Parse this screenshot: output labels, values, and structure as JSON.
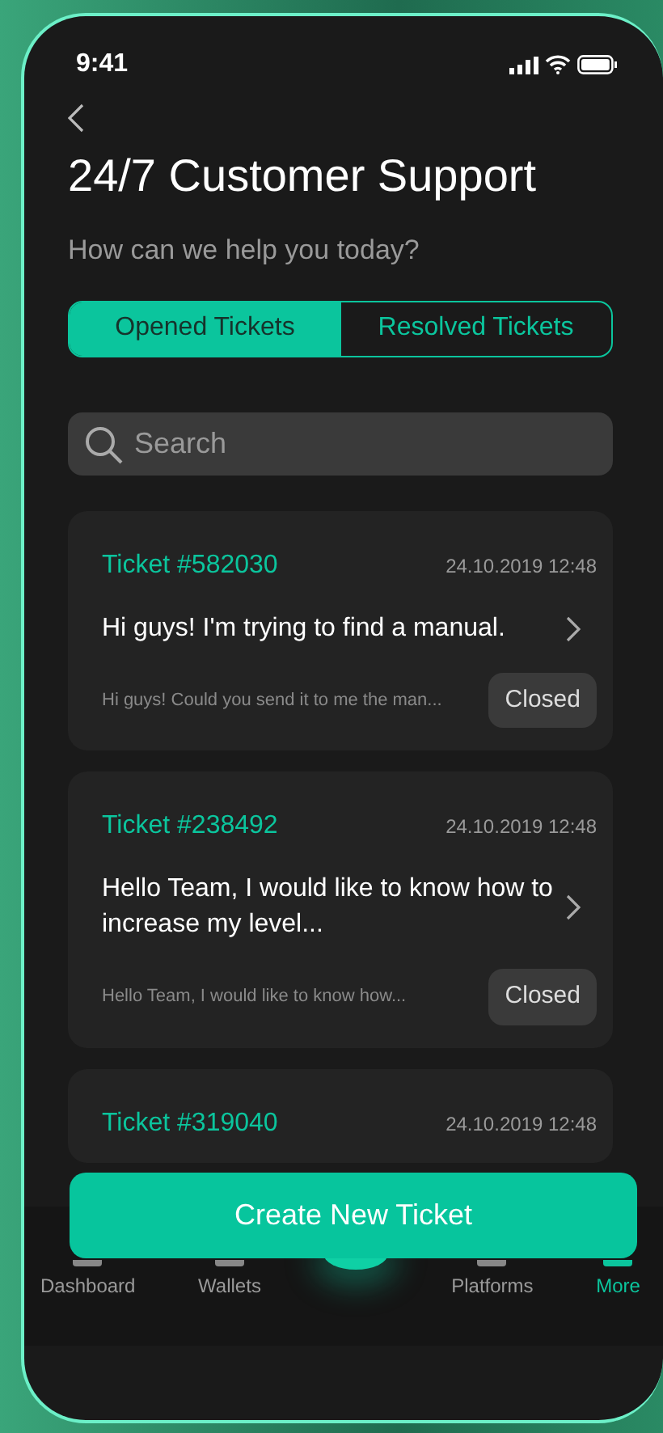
{
  "status_bar": {
    "time": "9:41"
  },
  "header": {
    "title": "24/7 Customer Support",
    "subtitle": "How can we help you today?"
  },
  "tabs": [
    {
      "label": "Opened Tickets",
      "selected": true
    },
    {
      "label": "Resolved Tickets",
      "selected": false
    }
  ],
  "search": {
    "placeholder": "Search"
  },
  "tickets": [
    {
      "number": "Ticket #582030",
      "date": "24.10.2019 12:48",
      "subject": "Hi guys! I'm trying to find a manual.",
      "preview": "Hi guys! Could you send it to me the man...",
      "status": "Closed"
    },
    {
      "number": "Ticket #238492",
      "date": "24.10.2019 12:48",
      "subject": "Hello Team, I would like to know how to increase my level...",
      "preview": "Hello Team, I would like to know how...",
      "status": "Closed"
    },
    {
      "number": "Ticket #319040",
      "date": "24.10.2019 12:48"
    }
  ],
  "create_button": {
    "label": "Create New Ticket"
  },
  "bottom_nav": [
    {
      "kind": "item",
      "label": "Dashboard",
      "selected": false
    },
    {
      "kind": "item",
      "label": "Wallets",
      "selected": false
    },
    {
      "kind": "center"
    },
    {
      "kind": "item",
      "label": "Platforms",
      "selected": false
    },
    {
      "kind": "item",
      "label": "More",
      "selected": true
    }
  ]
}
